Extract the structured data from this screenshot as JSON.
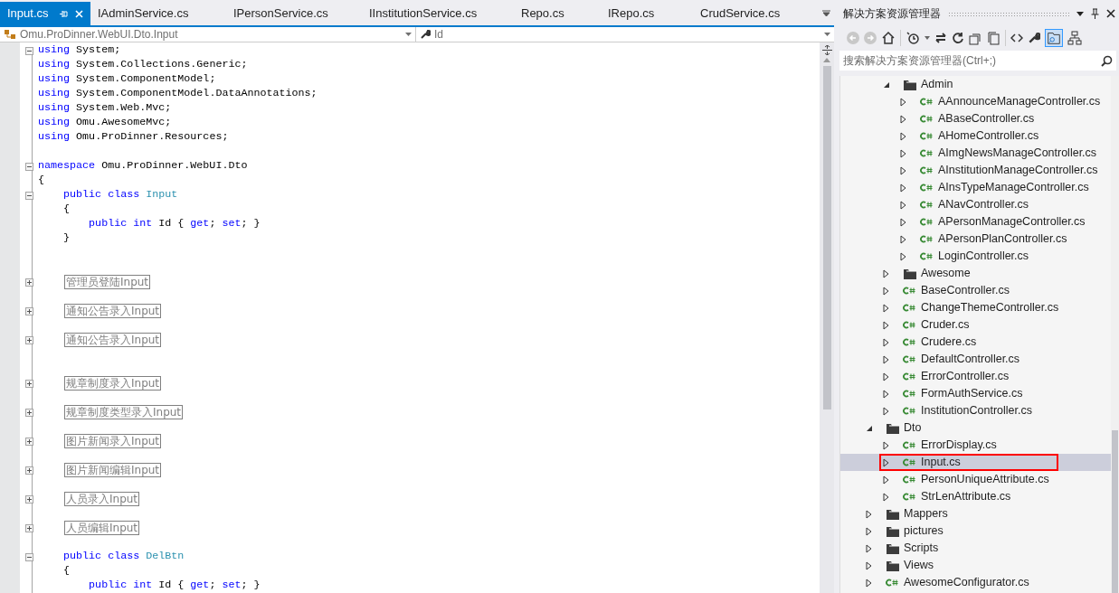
{
  "editor": {
    "tabs": [
      {
        "label": "Input.cs",
        "selected": true
      },
      {
        "label": "IAdminService.cs",
        "selected": false
      },
      {
        "label": "IPersonService.cs",
        "selected": false
      },
      {
        "label": "IInstitutionService.cs",
        "selected": false
      },
      {
        "label": "Repo.cs",
        "selected": false
      },
      {
        "label": "IRepo.cs",
        "selected": false
      },
      {
        "label": "CrudService.cs",
        "selected": false
      }
    ],
    "type_dropdown": "Omu.ProDinner.WebUI.Dto.Input",
    "member_dropdown": "Id",
    "lines": [
      {
        "kind": "code",
        "expanded": true,
        "tokens": [
          {
            "text": "using",
            "kind": "keyword"
          },
          {
            "text": " System;",
            "kind": "plain"
          }
        ]
      },
      {
        "kind": "code",
        "tokens": [
          {
            "text": "using",
            "kind": "keyword"
          },
          {
            "text": " System.Collections.Generic;",
            "kind": "plain"
          }
        ]
      },
      {
        "kind": "code",
        "tokens": [
          {
            "text": "using",
            "kind": "keyword"
          },
          {
            "text": " System.ComponentModel;",
            "kind": "plain"
          }
        ]
      },
      {
        "kind": "code",
        "tokens": [
          {
            "text": "using",
            "kind": "keyword"
          },
          {
            "text": " System.ComponentModel.DataAnnotations;",
            "kind": "plain"
          }
        ]
      },
      {
        "kind": "code",
        "tokens": [
          {
            "text": "using",
            "kind": "keyword"
          },
          {
            "text": " System.Web.Mvc;",
            "kind": "plain"
          }
        ]
      },
      {
        "kind": "code",
        "tokens": [
          {
            "text": "using",
            "kind": "keyword"
          },
          {
            "text": " Omu.AwesomeMvc;",
            "kind": "plain"
          }
        ]
      },
      {
        "kind": "code",
        "tokens": [
          {
            "text": "using",
            "kind": "keyword"
          },
          {
            "text": " Omu.ProDinner.Resources;",
            "kind": "plain"
          }
        ]
      },
      {
        "kind": "blank"
      },
      {
        "kind": "code",
        "expanded": true,
        "tokens": [
          {
            "text": "namespace",
            "kind": "keyword"
          },
          {
            "text": " Omu.ProDinner.WebUI.Dto",
            "kind": "plain"
          }
        ]
      },
      {
        "kind": "code",
        "tokens": [
          {
            "text": "{",
            "kind": "plain"
          }
        ]
      },
      {
        "kind": "code",
        "expanded": true,
        "tokens": [
          {
            "text": "    public class",
            "kind": "keyword"
          },
          {
            "text": " Input",
            "kind": "type"
          }
        ]
      },
      {
        "kind": "code",
        "tokens": [
          {
            "text": "    {",
            "kind": "plain"
          }
        ]
      },
      {
        "kind": "code",
        "tokens": [
          {
            "text": "        public int",
            "kind": "keyword"
          },
          {
            "text": " Id { ",
            "kind": "plain"
          },
          {
            "text": "get",
            "kind": "keyword"
          },
          {
            "text": "; ",
            "kind": "plain"
          },
          {
            "text": "set",
            "kind": "keyword"
          },
          {
            "text": "; }",
            "kind": "plain"
          }
        ]
      },
      {
        "kind": "code",
        "tokens": [
          {
            "text": "    }",
            "kind": "plain"
          }
        ]
      },
      {
        "kind": "blank"
      },
      {
        "kind": "blank"
      },
      {
        "kind": "region",
        "expanded": false,
        "text": "管理员登陆Input"
      },
      {
        "kind": "blank"
      },
      {
        "kind": "region",
        "expanded": false,
        "text": "通知公告录入Input"
      },
      {
        "kind": "blank"
      },
      {
        "kind": "region",
        "expanded": false,
        "text": "通知公告录入Input"
      },
      {
        "kind": "blank"
      },
      {
        "kind": "blank"
      },
      {
        "kind": "region",
        "expanded": false,
        "text": "规章制度录入Input"
      },
      {
        "kind": "blank"
      },
      {
        "kind": "region",
        "expanded": false,
        "text": "规章制度类型录入Input"
      },
      {
        "kind": "blank"
      },
      {
        "kind": "region",
        "expanded": false,
        "text": "图片新闻录入Input"
      },
      {
        "kind": "blank"
      },
      {
        "kind": "region",
        "expanded": false,
        "text": "图片新闻编辑Input"
      },
      {
        "kind": "blank"
      },
      {
        "kind": "region",
        "expanded": false,
        "text": "人员录入Input"
      },
      {
        "kind": "blank"
      },
      {
        "kind": "region",
        "expanded": false,
        "text": "人员编辑Input"
      },
      {
        "kind": "blank"
      },
      {
        "kind": "code",
        "expanded": true,
        "tokens": [
          {
            "text": "    public class",
            "kind": "keyword"
          },
          {
            "text": " DelBtn",
            "kind": "type"
          }
        ]
      },
      {
        "kind": "code",
        "tokens": [
          {
            "text": "    {",
            "kind": "plain"
          }
        ]
      },
      {
        "kind": "code",
        "tokens": [
          {
            "text": "        public int",
            "kind": "keyword"
          },
          {
            "text": " Id { ",
            "kind": "plain"
          },
          {
            "text": "get",
            "kind": "keyword"
          },
          {
            "text": "; ",
            "kind": "plain"
          },
          {
            "text": "set",
            "kind": "keyword"
          },
          {
            "text": "; }",
            "kind": "plain"
          }
        ]
      }
    ]
  },
  "solution_explorer": {
    "title": "解决方案资源管理器",
    "search": {
      "placeholder": "搜索解决方案资源管理器(Ctrl+;)"
    },
    "tree": [
      {
        "children": [
          {
            "label": "Admin",
            "kind": "folder",
            "expanded": true,
            "selected": false,
            "children": [
              {
                "label": "AAnnounceManageController.cs",
                "kind": "file",
                "expanded": false,
                "selected": false
              },
              {
                "label": "ABaseController.cs",
                "kind": "file",
                "expanded": false,
                "selected": false
              },
              {
                "label": "AHomeController.cs",
                "kind": "file",
                "expanded": false,
                "selected": false
              },
              {
                "label": "AImgNewsManageController.cs",
                "kind": "file",
                "expanded": false,
                "selected": false
              },
              {
                "label": "AInstitutionManageController.cs",
                "kind": "file",
                "expanded": false,
                "selected": false
              },
              {
                "label": "AInsTypeManageController.cs",
                "kind": "file",
                "expanded": false,
                "selected": false
              },
              {
                "label": "ANavController.cs",
                "kind": "file",
                "expanded": false,
                "selected": false
              },
              {
                "label": "APersonManageController.cs",
                "kind": "file",
                "expanded": false,
                "selected": false
              },
              {
                "label": "APersonPlanController.cs",
                "kind": "file",
                "expanded": false,
                "selected": false
              },
              {
                "label": "LoginController.cs",
                "kind": "file",
                "expanded": false,
                "selected": false
              }
            ]
          },
          {
            "label": "Awesome",
            "kind": "folder",
            "expanded": false,
            "selected": false
          },
          {
            "label": "BaseController.cs",
            "kind": "file",
            "expanded": false,
            "selected": false
          },
          {
            "label": "ChangeThemeController.cs",
            "kind": "file",
            "expanded": false,
            "selected": false
          },
          {
            "label": "Cruder.cs",
            "kind": "file",
            "expanded": false,
            "selected": false
          },
          {
            "label": "Crudere.cs",
            "kind": "file",
            "expanded": false,
            "selected": false
          },
          {
            "label": "DefaultController.cs",
            "kind": "file",
            "expanded": false,
            "selected": false
          },
          {
            "label": "ErrorController.cs",
            "kind": "file",
            "expanded": false,
            "selected": false
          },
          {
            "label": "FormAuthService.cs",
            "kind": "file",
            "expanded": false,
            "selected": false
          },
          {
            "label": "InstitutionController.cs",
            "kind": "file",
            "expanded": false,
            "selected": false
          }
        ]
      },
      {
        "label": "Dto",
        "kind": "folder",
        "expanded": true,
        "selected": false,
        "children": [
          {
            "label": "ErrorDisplay.cs",
            "kind": "file",
            "expanded": false,
            "selected": false
          },
          {
            "label": "Input.cs",
            "kind": "file",
            "expanded": false,
            "selected": true
          },
          {
            "label": "PersonUniqueAttribute.cs",
            "kind": "file",
            "expanded": false,
            "selected": false
          },
          {
            "label": "StrLenAttribute.cs",
            "kind": "file",
            "expanded": false,
            "selected": false
          }
        ]
      },
      {
        "label": "Mappers",
        "kind": "folder",
        "expanded": false,
        "selected": false
      },
      {
        "label": "pictures",
        "kind": "folder",
        "expanded": false,
        "selected": false
      },
      {
        "label": "Scripts",
        "kind": "folder",
        "expanded": false,
        "selected": false
      },
      {
        "label": "Views",
        "kind": "folder",
        "expanded": false,
        "selected": false
      },
      {
        "label": "AwesomeConfigurator.cs",
        "kind": "file",
        "expanded": false,
        "selected": false
      }
    ]
  }
}
